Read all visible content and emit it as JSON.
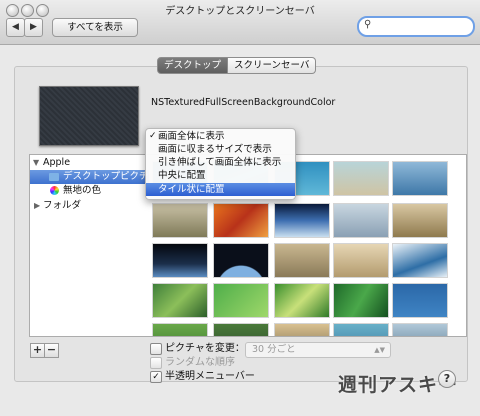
{
  "window": {
    "title": "デスクトップとスクリーンセーバ",
    "show_all_label": "すべてを表示",
    "back_label": "◀",
    "forward_label": "▶",
    "search": {
      "value": "",
      "placeholder": ""
    }
  },
  "tabs": [
    {
      "label": "デスクトップ",
      "selected": true
    },
    {
      "label": "スクリーンセーバ",
      "selected": false
    }
  ],
  "current_image_name": "NSTexturedFullScreenBackgroundColor",
  "sidebar": {
    "apple_label": "Apple",
    "desktop_pictures_label": "デスクトップピクチャ",
    "solid_colors_label": "無地の色",
    "folders_label": "フォルダ"
  },
  "fit_menu": {
    "items": [
      {
        "label": "画面全体に表示",
        "checked": true,
        "highlighted": false
      },
      {
        "label": "画面に収まるサイズで表示",
        "checked": false,
        "highlighted": false
      },
      {
        "label": "引き伸ばして画面全体に表示",
        "checked": false,
        "highlighted": false
      },
      {
        "label": "中央に配置",
        "checked": false,
        "highlighted": false
      },
      {
        "label": "タイル状に配置",
        "checked": false,
        "highlighted": true
      }
    ],
    "checkmark": "✓"
  },
  "thumbnails": [
    "ocean-waves",
    "blue-water-texture",
    "beach-shore",
    "frosty-trees",
    "wheat-grass",
    "autumn-leaves",
    "earth-horizon",
    "foggy-lake",
    "bird-in-sky",
    "earth-from-space",
    "earth-limb",
    "elephant",
    "zebra-herd",
    "ice-floe",
    "leaves-green",
    "water-drops",
    "frog-on-leaf",
    "grass-blades",
    "blue-sea",
    "green-field",
    "forest-edge",
    "sunset-rocks",
    "lagoon",
    "mountain-lake"
  ],
  "buttons": {
    "add": "+",
    "remove": "−"
  },
  "change_picture": {
    "label": "ピクチャを変更：",
    "checked": false
  },
  "interval": {
    "value": "30 分ごと"
  },
  "random_order": {
    "label": "ランダムな順序",
    "checked": false
  },
  "translucent_menu_bar": {
    "label": "半透明メニューバー",
    "checked": true
  },
  "watermark": "週刊アスキー",
  "help_label": "?",
  "colors": {
    "selection": "#3d71cf",
    "menu_highlight": "#2d5fd2",
    "search_focus": "#6fa0e6"
  }
}
